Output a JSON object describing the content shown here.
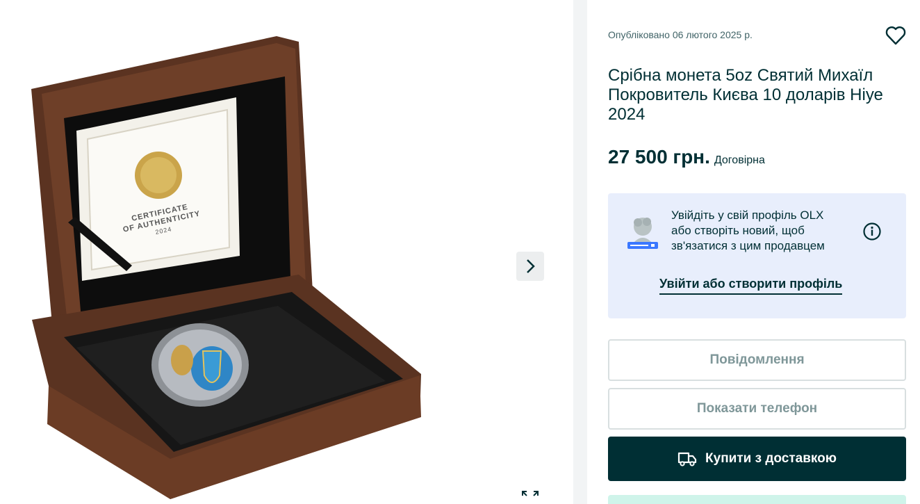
{
  "gallery": {
    "next_icon": "chevron-right-icon",
    "expand_icon": "expand-icon",
    "certificate": {
      "line1": "CERTIFICATE",
      "line2": "OF AUTHENTICITY",
      "year": "2024"
    }
  },
  "listing": {
    "published": "Опубліковано 06 лютого 2025 р.",
    "title": "Срібна монета 5oz Святий Михаїл Покровитель Києва 10 доларів Ніуе 2024",
    "price": "27 500 грн.",
    "negotiable": "Договірна",
    "favorite_icon": "heart-icon"
  },
  "login_card": {
    "text": "Увійдіть у свій профіль OLX або створіть новий, щоб зв'язатися з цим продавцем",
    "link": "Увійти або створити профіль",
    "info_icon": "info-icon"
  },
  "actions": {
    "message": "Повідомлення",
    "phone": "Показати телефон",
    "buy": "Купити з доставкою",
    "buy_icon": "delivery-truck-icon"
  },
  "colors": {
    "primary": "#002f34",
    "card_bg": "#e8eefc",
    "muted_button_text": "#7f9799",
    "delivery_hint": "#cff4ea"
  }
}
